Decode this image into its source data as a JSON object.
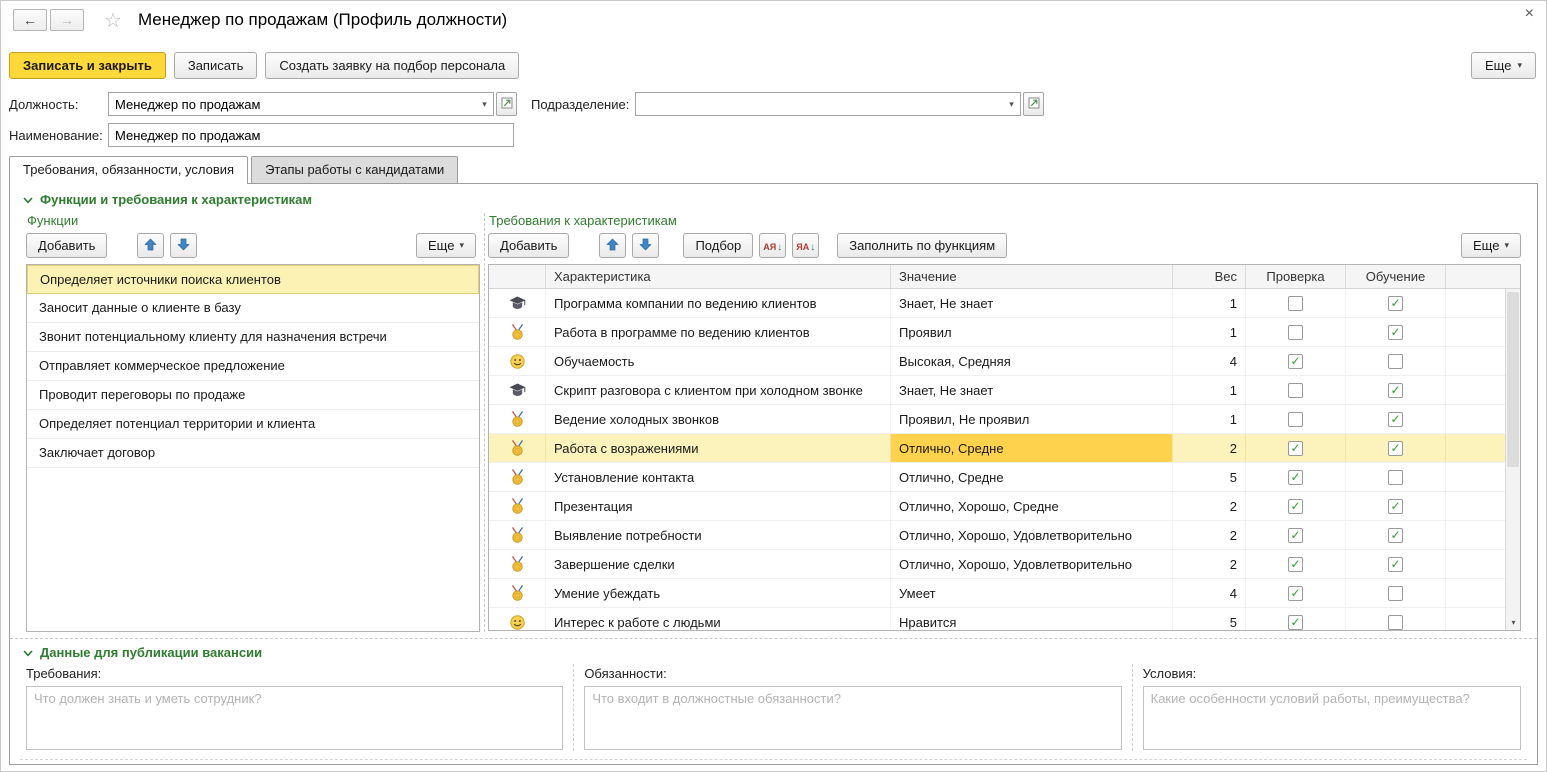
{
  "window": {
    "title": "Менеджер по продажам (Профиль должности)",
    "close_glyph": "×",
    "back_glyph": "←",
    "forward_glyph": "→",
    "star_glyph": "☆"
  },
  "icons": {
    "caret_down": "▾",
    "arrow_down_small": "↓",
    "check": "✓",
    "scroll_down": "▾"
  },
  "colors": {
    "accent_yellow": "#FFD83A",
    "selection_yellow": "#FCF2BC",
    "highlight_gold": "#FFD24D",
    "section_green": "#2F7D2F",
    "check_green": "#2F9E2F"
  },
  "toolbar": {
    "save_close_label": "Записать и закрыть",
    "save_label": "Записать",
    "create_request_label": "Создать заявку на подбор персонала",
    "more_label": "Еще"
  },
  "form": {
    "position_label": "Должность:",
    "position_value": "Менеджер по продажам",
    "department_label": "Подразделение:",
    "department_value": "",
    "name_label": "Наименование:",
    "name_value": "Менеджер по продажам"
  },
  "tabs": [
    {
      "label": "Требования, обязанности, условия",
      "active": true
    },
    {
      "label": "Этапы работы с кандидатами",
      "active": false
    }
  ],
  "functions_section": {
    "title": "Функции и требования к характеристикам",
    "functions_panel": {
      "title": "Функции",
      "add_label": "Добавить",
      "more_label": "Еще",
      "items": [
        {
          "label": "Определяет источники поиска клиентов",
          "selected": true
        },
        {
          "label": "Заносит данные о клиенте в базу",
          "selected": false
        },
        {
          "label": "Звонит потенциальному клиенту для назначения встречи",
          "selected": false
        },
        {
          "label": "Отправляет коммерческое предложение",
          "selected": false
        },
        {
          "label": "Проводит переговоры по продаже",
          "selected": false
        },
        {
          "label": "Определяет потенциал территории и клиента",
          "selected": false
        },
        {
          "label": "Заключает договор",
          "selected": false
        }
      ]
    },
    "requirements_panel": {
      "title": "Требования к характеристикам",
      "add_label": "Добавить",
      "pick_label": "Подбор",
      "fill_label": "Заполнить по функциям",
      "more_label": "Еще",
      "sort_asc_letters": "АЯ",
      "sort_desc_letters": "ЯА",
      "columns": [
        "Характеристика",
        "Значение",
        "Вес",
        "Проверка",
        "Обучение"
      ],
      "rows": [
        {
          "icon": "graduation-cap",
          "name": "Программа компании по ведению клиентов",
          "value": "Знает, Не знает",
          "weight": 1,
          "check": false,
          "training": true,
          "selected": false
        },
        {
          "icon": "medal",
          "name": "Работа в программе по ведению клиентов",
          "value": "Проявил",
          "weight": 1,
          "check": false,
          "training": true,
          "selected": false
        },
        {
          "icon": "smiley",
          "name": "Обучаемость",
          "value": "Высокая, Средняя",
          "weight": 4,
          "check": true,
          "training": false,
          "selected": false
        },
        {
          "icon": "graduation-cap",
          "name": "Скрипт разговора с клиентом при холодном звонке",
          "value": "Знает, Не знает",
          "weight": 1,
          "check": false,
          "training": true,
          "selected": false
        },
        {
          "icon": "medal",
          "name": "Ведение холодных звонков",
          "value": "Проявил, Не проявил",
          "weight": 1,
          "check": false,
          "training": true,
          "selected": false
        },
        {
          "icon": "medal",
          "name": "Работа с возражениями",
          "value": "Отлично, Средне",
          "weight": 2,
          "check": true,
          "training": true,
          "selected": true
        },
        {
          "icon": "medal",
          "name": "Установление контакта",
          "value": "Отлично, Средне",
          "weight": 5,
          "check": true,
          "training": false,
          "selected": false
        },
        {
          "icon": "medal",
          "name": "Презентация",
          "value": "Отлично, Хорошо, Средне",
          "weight": 2,
          "check": true,
          "training": true,
          "selected": false
        },
        {
          "icon": "medal",
          "name": "Выявление потребности",
          "value": "Отлично, Хорошо, Удовлетворительно",
          "weight": 2,
          "check": true,
          "training": true,
          "selected": false
        },
        {
          "icon": "medal",
          "name": "Завершение сделки",
          "value": "Отлично, Хорошо, Удовлетворительно",
          "weight": 2,
          "check": true,
          "training": true,
          "selected": false
        },
        {
          "icon": "medal",
          "name": "Умение убеждать",
          "value": "Умеет",
          "weight": 4,
          "check": true,
          "training": false,
          "selected": false
        },
        {
          "icon": "smiley",
          "name": "Интерес к работе с людьми",
          "value": "Нравится",
          "weight": 5,
          "check": true,
          "training": false,
          "selected": false
        }
      ]
    }
  },
  "publication_section": {
    "title": "Данные для публикации вакансии",
    "fields": [
      {
        "label": "Требования:",
        "placeholder": "Что должен знать и уметь сотрудник?"
      },
      {
        "label": "Обязанности:",
        "placeholder": "Что входит в должностные обязанности?"
      },
      {
        "label": "Условия:",
        "placeholder": "Какие особенности условий работы, преимущества?"
      }
    ]
  }
}
